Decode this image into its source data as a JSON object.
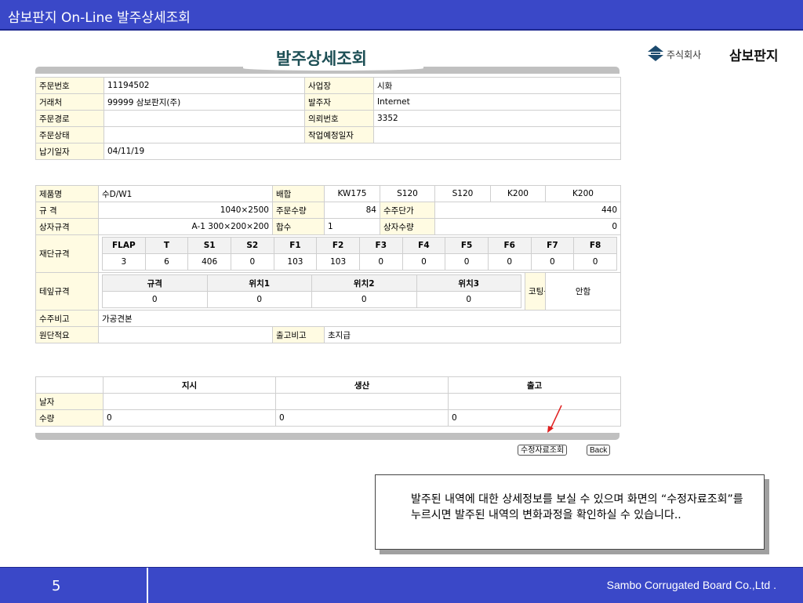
{
  "header": {
    "title": "삼보판지 On-Line 발주상세조회"
  },
  "logo": {
    "company_prefix": "주식회사",
    "company_name": "삼보판지"
  },
  "page_title": "발주상세조회",
  "order_info": {
    "order_no_label": "주문번호",
    "order_no": "11194502",
    "site_label": "사업장",
    "site": "시화",
    "customer_label": "거래처",
    "customer": "99999 삼보판지(주)",
    "orderer_label": "발주자",
    "orderer": "Internet",
    "route_label": "주문경로",
    "route": "",
    "request_no_label": "의뢰번호",
    "request_no": "3352",
    "status_label": "주문상태",
    "status": "",
    "work_date_label": "작업예정일자",
    "work_date": "",
    "delivery_label": "납기일자",
    "delivery": "04/11/19"
  },
  "product": {
    "name_label": "제품명",
    "name": "수D/W1",
    "mix_label": "배합",
    "mix": [
      "KW175",
      "S120",
      "S120",
      "K200",
      "K200"
    ],
    "spec_label": "규 격",
    "spec": "1040×2500",
    "order_qty_label": "주문수량",
    "order_qty": "84",
    "unit_price_label": "수주단가",
    "unit_price": "440",
    "box_spec_label": "상자규격",
    "box_spec": "A-1 300×200×200",
    "count_label": "합수",
    "count": "1",
    "box_qty_label": "상자수량",
    "box_qty": "0",
    "cut_label": "재단규격",
    "cut_headers": [
      "FLAP",
      "T",
      "S1",
      "S2",
      "F1",
      "F2",
      "F3",
      "F4",
      "F5",
      "F6",
      "F7",
      "F8"
    ],
    "cut_values": [
      "3",
      "6",
      "406",
      "0",
      "103",
      "103",
      "0",
      "0",
      "0",
      "0",
      "0",
      "0"
    ],
    "tape_label": "테잎규격",
    "tape_headers": [
      "규격",
      "위치1",
      "위치2",
      "위치3"
    ],
    "tape_values": [
      "0",
      "0",
      "0",
      "0"
    ],
    "coating_label": "코팅구분",
    "coating": "안함",
    "remark_label": "수주비고",
    "remark": "가공견본",
    "raw_label": "원단적요",
    "raw": "",
    "ship_remark_label": "출고비고",
    "ship_remark": "초지급"
  },
  "progress": {
    "headers": [
      "지시",
      "생산",
      "출고"
    ],
    "date_label": "날자",
    "dates": [
      "",
      "",
      ""
    ],
    "qty_label": "수량",
    "qtys": [
      "0",
      "0",
      "0"
    ]
  },
  "buttons": {
    "history": "수정자료조회",
    "back": "Back"
  },
  "callout": {
    "text": "발주된 내역에 대한 상세정보를 보실 수 있으며  화면의 “수정자료조회”를 누르시면 발주된 내역의 변화과정을 확인하실 수 있습니다.."
  },
  "footer": {
    "page": "5",
    "company": "Sambo Corrugated Board Co.,Ltd ."
  },
  "colors": {
    "bar": "#3a48c8",
    "label_bg": "#fffbe2",
    "title": "#1d4f55",
    "arrow": "#e02020"
  }
}
